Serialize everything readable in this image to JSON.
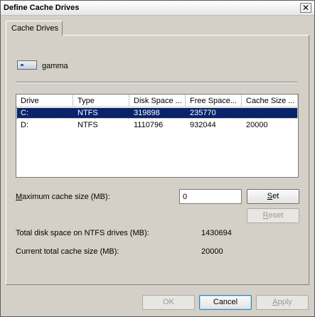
{
  "window": {
    "title": "Define Cache Drives",
    "close_glyph": "✕"
  },
  "tab": {
    "label": "Cache Drives"
  },
  "server": {
    "name": "gamma"
  },
  "list": {
    "columns": [
      "Drive",
      "Type",
      "Disk Space ...",
      "Free Space...",
      "Cache Size ..."
    ],
    "rows": [
      {
        "drive": "C:",
        "type": "NTFS",
        "disk_space": "319898",
        "free_space": "235770",
        "cache_size": "",
        "selected": true
      },
      {
        "drive": "D:",
        "type": "NTFS",
        "disk_space": "1110796",
        "free_space": "932044",
        "cache_size": "20000",
        "selected": false
      }
    ]
  },
  "max_cache": {
    "label_prefix": "M",
    "label_rest": "aximum cache size (MB):",
    "value": "0"
  },
  "buttons": {
    "set_u": "S",
    "set_rest": "et",
    "reset_u": "R",
    "reset_rest": "eset",
    "ok": "OK",
    "cancel": "Cancel",
    "apply_u": "A",
    "apply_rest": "pply"
  },
  "totals": {
    "disk_label": "Total disk space on NTFS drives (MB):",
    "disk_value": "1430694",
    "cache_label": "Current total cache size (MB):",
    "cache_value": "20000"
  }
}
